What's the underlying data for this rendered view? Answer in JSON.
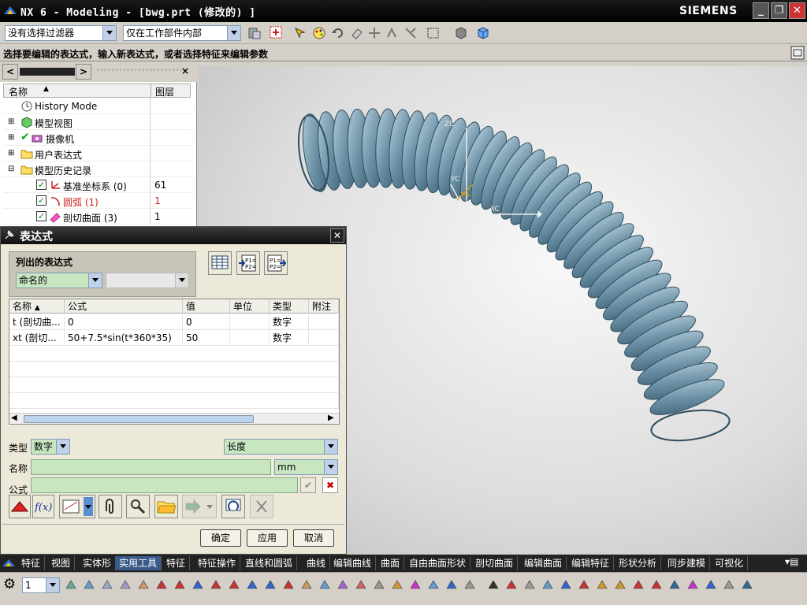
{
  "window": {
    "title": "NX 6 - Modeling - [bwg.prt (修改的) ]",
    "brand": "SIEMENS",
    "min_glyph": "_",
    "max_glyph": "❐",
    "close_glyph": "✕"
  },
  "toolbar": {
    "filter_value": "没有选择过滤器",
    "scope_value": "仅在工作部件内部"
  },
  "cue": "选择要编辑的表达式，输入新表达式，或者选择特征来编辑参数",
  "navigator": {
    "back_glyph": "<",
    "fwd_glyph": ">",
    "close_glyph": "×",
    "col_name": "名称",
    "col_layer": "图层",
    "rows": [
      {
        "label": "History Mode",
        "layer": ""
      },
      {
        "label": "模型视图",
        "layer": ""
      },
      {
        "label": "摄像机",
        "layer": ""
      },
      {
        "label": "用户表达式",
        "layer": ""
      },
      {
        "label": "模型历史记录",
        "layer": ""
      },
      {
        "label": "基准坐标系 (0)",
        "layer": "61"
      },
      {
        "label": "圆弧 (1)",
        "layer": "1"
      },
      {
        "label": "剖切曲面 (3)",
        "layer": "1"
      }
    ]
  },
  "dialog": {
    "title": "表达式",
    "close_glyph": "✕",
    "listed_group": "列出的表达式",
    "listed_value": "命名的",
    "columns": [
      "名称",
      "公式",
      "值",
      "单位",
      "类型",
      "附注"
    ],
    "rows": [
      {
        "name": "t (剖切曲...",
        "formula": "0",
        "value": "0",
        "unit": "",
        "type": "数字",
        "note": ""
      },
      {
        "name": "xt (剖切...",
        "formula": "50+7.5*sin(t*360*35)",
        "value": "50",
        "unit": "",
        "type": "数字",
        "note": ""
      }
    ],
    "type_label": "类型",
    "type_value": "数字",
    "dimension_value": "长度",
    "name_label": "名称",
    "name_value": "",
    "unit_value": "mm",
    "formula_label": "公式",
    "formula_value": "",
    "ok": "确定",
    "apply": "应用",
    "cancel": "取消"
  },
  "bottom_tabs": [
    "特征",
    "视图",
    "实体形",
    "实用工具",
    "特征",
    "特征操作",
    "直线和圆弧",
    "曲线",
    "编辑曲线",
    "曲面",
    "自由曲面形状",
    "剖切曲面",
    "编辑曲面",
    "编辑特征",
    "形状分析",
    "同步建模",
    "可视化"
  ],
  "bottom_toolbar": {
    "layer_value": "1"
  },
  "model_labels": {
    "zc": "ZC",
    "yc": "YC",
    "xc": "XC"
  }
}
